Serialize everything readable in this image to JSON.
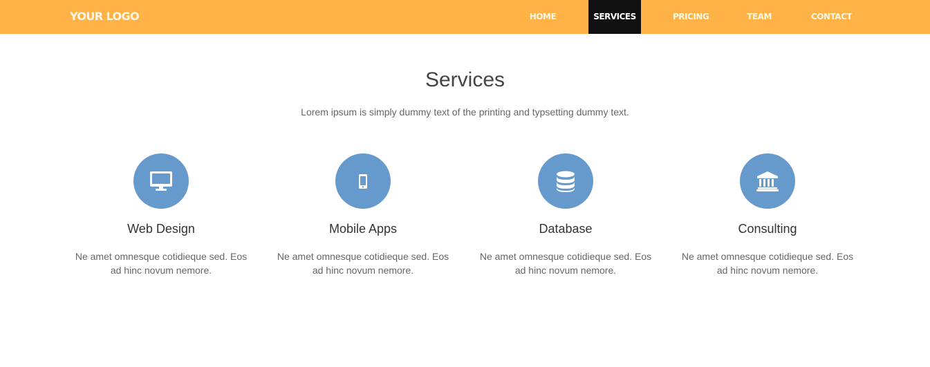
{
  "header": {
    "logo": "YOUR LOGO",
    "nav": [
      "HOME",
      "SERVICES",
      "PRICING",
      "TEAM",
      "CONTACT"
    ],
    "active": "SERVICES"
  },
  "main": {
    "title": "Services",
    "subtitle": "Lorem ipsum is simply dummy text of the printing and typsetting dummy text.",
    "services": [
      {
        "icon": "desktop-icon",
        "title": "Web Design",
        "text": "Ne amet omnesque cotidieque sed. Eos ad hinc novum nemore."
      },
      {
        "icon": "mobile-icon",
        "title": "Mobile Apps",
        "text": "Ne amet omnesque cotidieque sed. Eos ad hinc novum nemore."
      },
      {
        "icon": "database-icon",
        "title": "Database",
        "text": "Ne amet omnesque cotidieque sed. Eos ad hinc novum nemore."
      },
      {
        "icon": "bank-icon",
        "title": "Consulting",
        "text": "Ne amet omnesque cotidieque sed. Eos ad hinc novum nemore."
      }
    ]
  },
  "colors": {
    "header_bg": "#ffb347",
    "active_nav_bg": "#111111",
    "icon_circle": "#6699cc"
  }
}
